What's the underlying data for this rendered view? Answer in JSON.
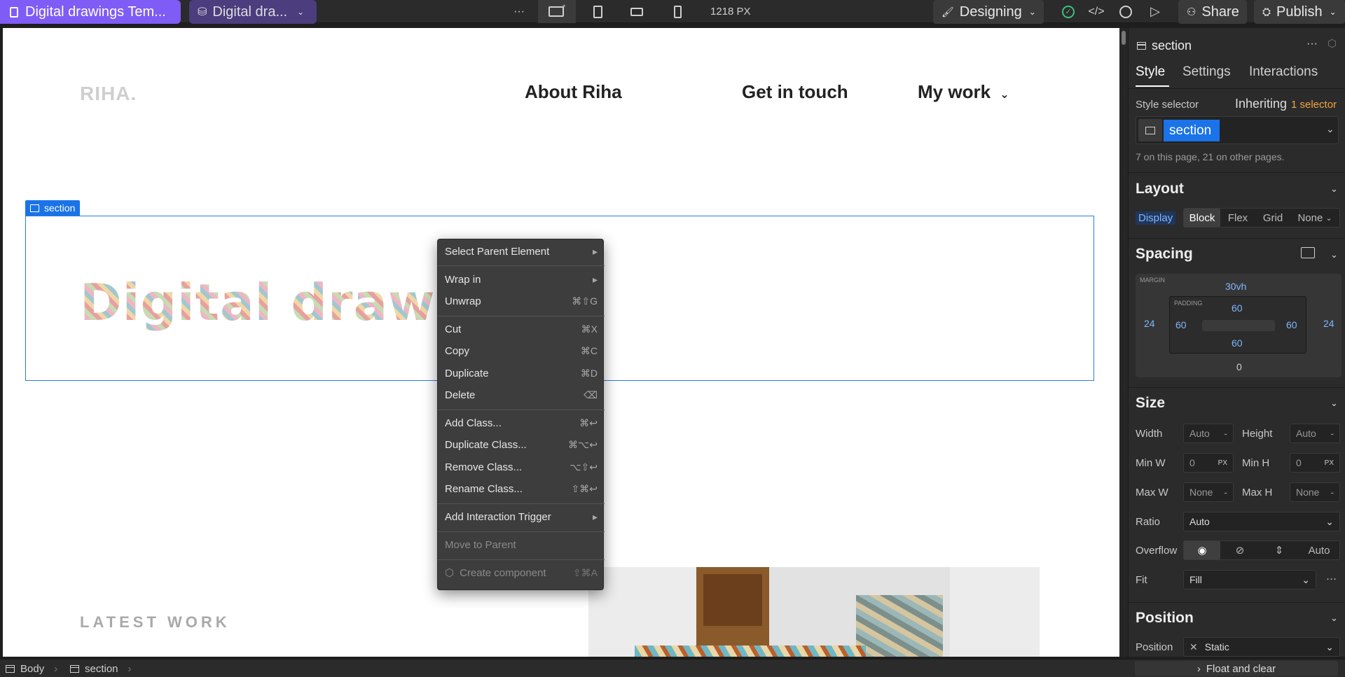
{
  "topbar": {
    "site_name": "Digital drawings Tem...",
    "cms_label": "Digital dra...",
    "more": "···",
    "width_readout": "1218 PX",
    "mode": "Designing",
    "share": "Share",
    "publish": "Publish"
  },
  "canvas": {
    "logo": "RIHA.",
    "nav": [
      "About Riha",
      "Get in touch",
      "My work"
    ],
    "section_badge": "section",
    "hero_text": "Digital drawing",
    "latest_work": "LATEST WORK"
  },
  "context_menu": {
    "items": [
      {
        "label": "Select Parent Element",
        "shortcut": "▸"
      },
      {
        "label": "Wrap in",
        "shortcut": "▸"
      },
      {
        "label": "Unwrap",
        "shortcut": "⌘⇧G"
      },
      {
        "label": "Cut",
        "shortcut": "⌘X"
      },
      {
        "label": "Copy",
        "shortcut": "⌘C"
      },
      {
        "label": "Duplicate",
        "shortcut": "⌘D"
      },
      {
        "label": "Delete",
        "shortcut": "⌫"
      },
      {
        "label": "Add Class...",
        "shortcut": "⌘↩"
      },
      {
        "label": "Duplicate Class...",
        "shortcut": "⌘⌥↩"
      },
      {
        "label": "Remove Class...",
        "shortcut": "⌥⇧↩"
      },
      {
        "label": "Rename Class...",
        "shortcut": "⇧⌘↩"
      },
      {
        "label": "Add Interaction Trigger",
        "shortcut": "▸"
      },
      {
        "label": "Move to Parent",
        "shortcut": ""
      },
      {
        "label": "Create component",
        "shortcut": "⇧⌘A"
      }
    ]
  },
  "panel": {
    "element_name": "section",
    "tabs": [
      "Style",
      "Settings",
      "Interactions"
    ],
    "style_selector_label": "Style selector",
    "inheriting_label": "Inheriting",
    "inheriting_count": "1 selector",
    "selector_chip": "section",
    "usage_note": "7 on this page, 21 on other pages.",
    "layout": {
      "title": "Layout",
      "display_label": "Display",
      "options": [
        "Block",
        "Flex",
        "Grid",
        "None"
      ]
    },
    "spacing": {
      "title": "Spacing",
      "margin_label": "MARGIN",
      "padding_label": "PADDING",
      "margin_top": "30vh",
      "margin_left": "24",
      "margin_right": "24",
      "margin_bottom": "0",
      "padding_top": "60",
      "padding_left": "60",
      "padding_right": "60",
      "padding_bottom": "60"
    },
    "size": {
      "title": "Size",
      "width_label": "Width",
      "width_val": "Auto",
      "height_label": "Height",
      "height_val": "Auto",
      "minw_label": "Min W",
      "minw_val": "0",
      "minh_label": "Min H",
      "minh_val": "0",
      "maxw_label": "Max W",
      "maxw_val": "None",
      "maxh_label": "Max H",
      "maxh_val": "None",
      "unit": "PX",
      "ratio_label": "Ratio",
      "ratio_val": "Auto",
      "overflow_label": "Overflow",
      "overflow_auto": "Auto",
      "fit_label": "Fit",
      "fit_val": "Fill"
    },
    "position": {
      "title": "Position",
      "label": "Position",
      "value": "Static",
      "float_clear": "Float and clear"
    }
  },
  "statusbar": {
    "crumbs": [
      "Body",
      "section"
    ]
  },
  "colors": {
    "accent_purple": "#7e5cf5",
    "selection_blue": "#1a73e8"
  }
}
